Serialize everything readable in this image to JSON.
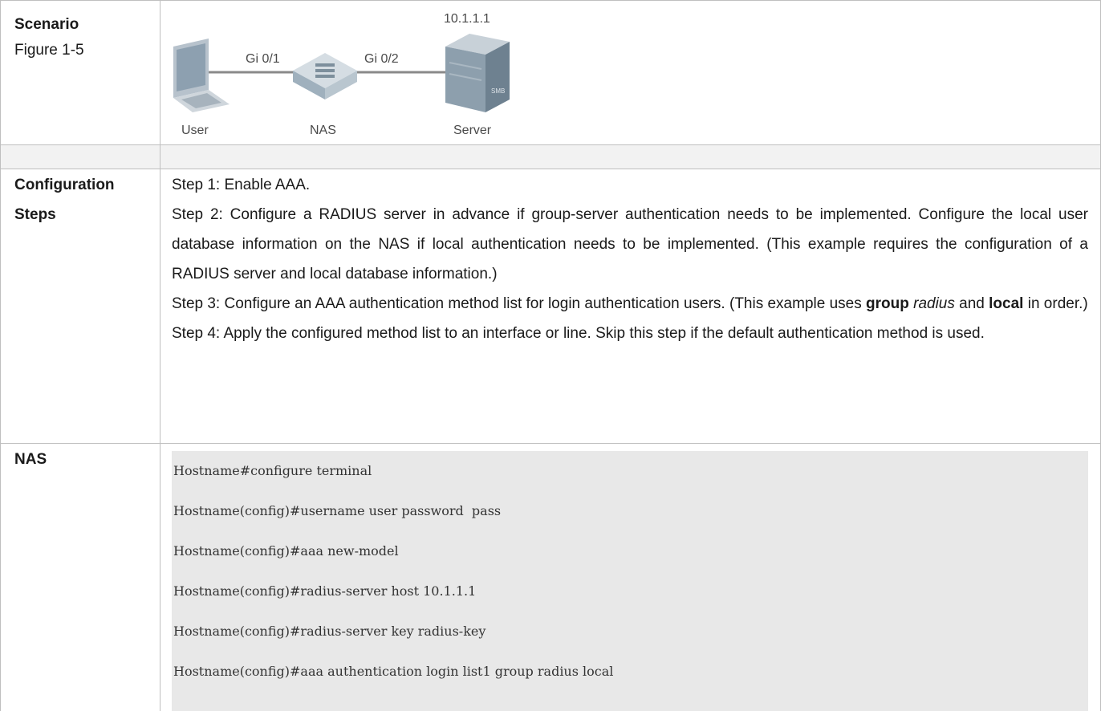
{
  "scenario": {
    "label": "Scenario",
    "figure_ref": "Figure 1-5",
    "diagram": {
      "server_ip": "10.1.1.1",
      "link1_label": "Gi 0/1",
      "link2_label": "Gi 0/2",
      "user_label": "User",
      "nas_label": "NAS",
      "server_label": "Server"
    }
  },
  "steps": {
    "label_line1": "Configuration",
    "label_line2": "Steps",
    "step1": "Step 1: Enable AAA.",
    "step2": "Step 2: Configure a RADIUS server in advance if group-server authentication needs to be implemented. Configure the local user database information on the NAS if local authentication needs to be implemented. (This example requires the configuration of a RADIUS server and local database information.)",
    "step3_prefix": "Step 3: Configure an AAA authentication method list for login authentication users. (This example uses ",
    "step3_bold1": "group",
    "step3_italic": "radius",
    "step3_mid": " and ",
    "step3_bold2": "local",
    "step3_suffix": " in order.)",
    "step4": "Step 4: Apply the configured method list to an interface or line. Skip this step if the default authentication method is used."
  },
  "nas": {
    "label": "NAS",
    "code_lines": [
      "Hostname#configure terminal",
      "Hostname(config)#username user password  pass",
      "Hostname(config)#aaa new-model",
      "Hostname(config)#radius-server host 10.1.1.1",
      "Hostname(config)#radius-server key radius-key",
      "Hostname(config)#aaa authentication login list1 group radius local"
    ]
  }
}
